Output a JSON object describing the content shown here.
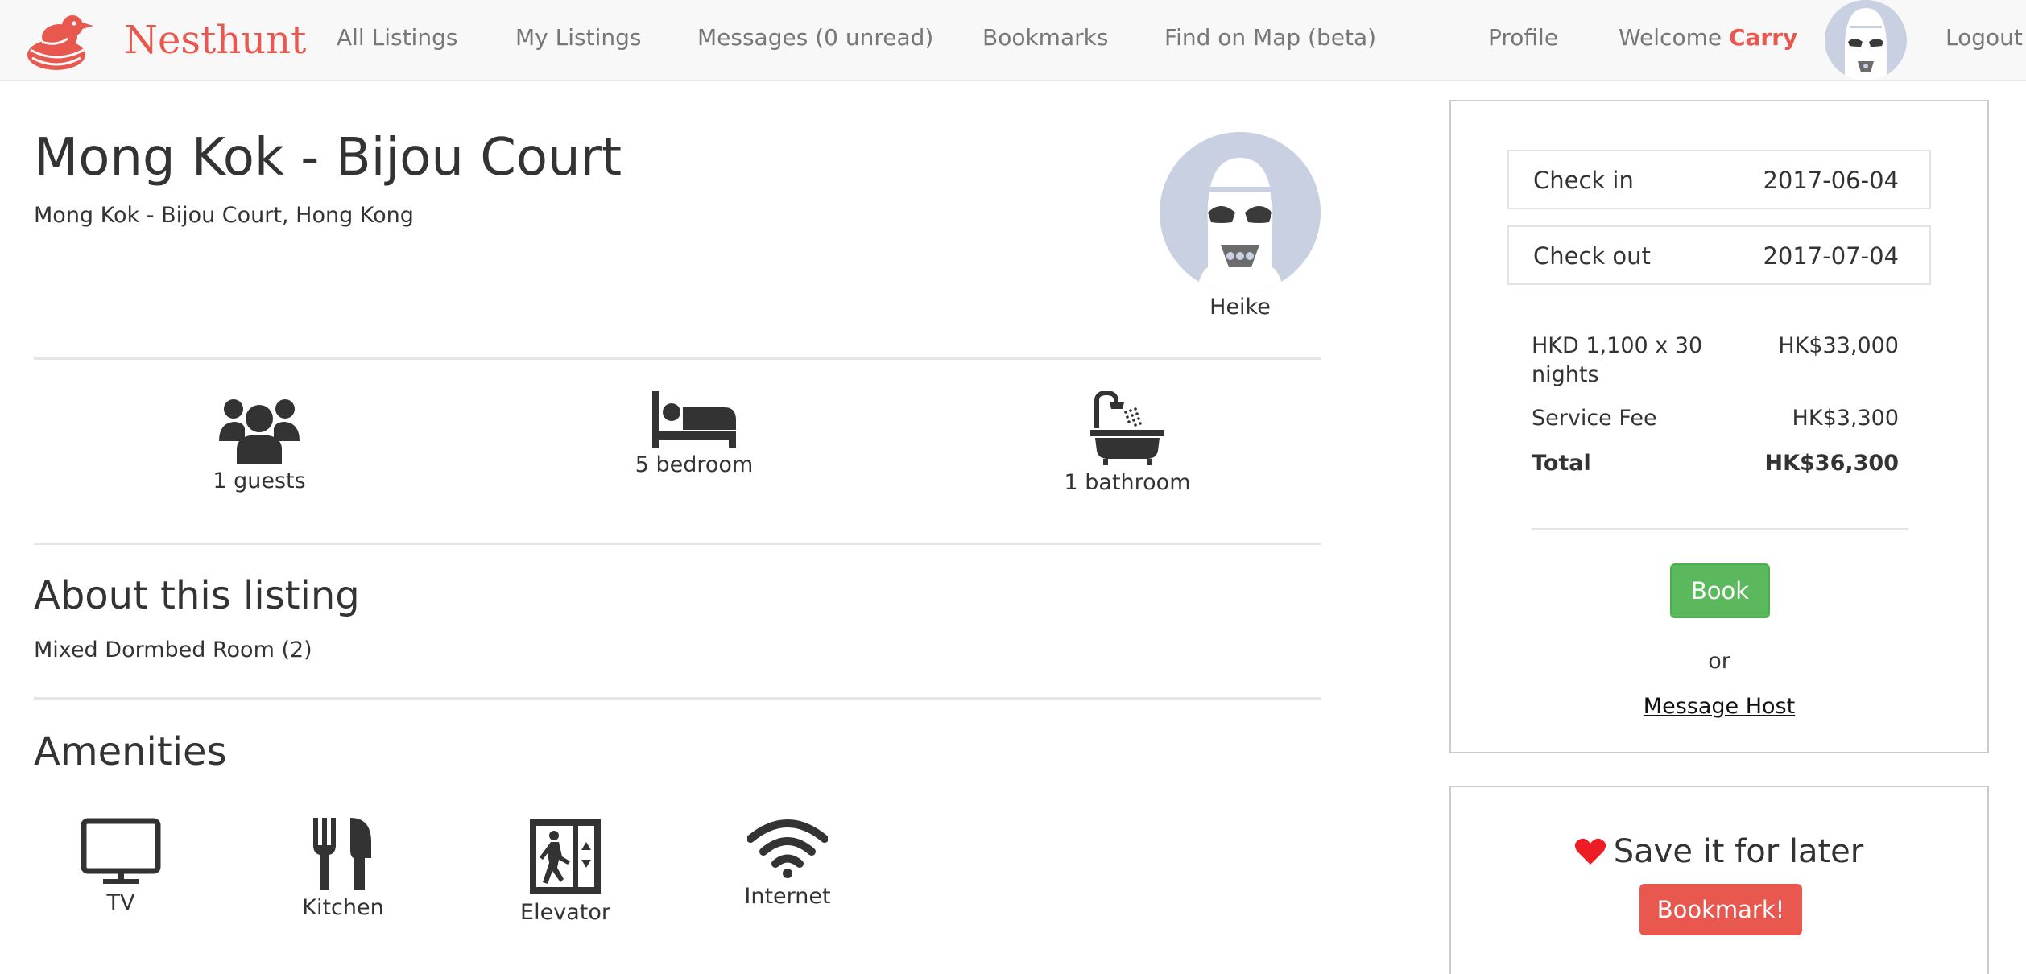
{
  "navbar": {
    "brand_name": "Nesthunt",
    "links": [
      {
        "label": "All Listings"
      },
      {
        "label": "My Listings"
      },
      {
        "label": "Messages (0 unread)"
      },
      {
        "label": "Bookmarks"
      },
      {
        "label": "Find on Map (beta)"
      },
      {
        "label": "Profile"
      }
    ],
    "welcome_prefix": "Welcome",
    "welcome_name": "Carry",
    "logout_label": "Logout"
  },
  "listing": {
    "title": "Mong Kok - Bijou Court",
    "address": "Mong Kok - Bijou Court, Hong Kong",
    "host_name": "Heike",
    "stats": {
      "guests": "1 guests",
      "bedrooms": "5 bedroom",
      "bathrooms": "1 bathroom"
    },
    "about_heading": "About this listing",
    "about_text": "Mixed Dormbed Room (2)",
    "amenities_heading": "Amenities",
    "amenities": [
      {
        "label": "TV",
        "icon": "tv-icon"
      },
      {
        "label": "Kitchen",
        "icon": "fork-knife-icon"
      },
      {
        "label": "Elevator",
        "icon": "elevator-icon"
      },
      {
        "label": "Internet",
        "icon": "wifi-icon"
      }
    ]
  },
  "booking": {
    "check_in_label": "Check in",
    "check_in_value": "2017-06-04",
    "check_out_label": "Check out",
    "check_out_value": "2017-07-04",
    "nightly_label": "HKD 1,100 x 30 nights",
    "nightly_value": "HK$33,000",
    "fee_label": "Service Fee",
    "fee_value": "HK$3,300",
    "total_label": "Total",
    "total_value": "HK$36,300",
    "book_label": "Book",
    "or_text": "or",
    "message_host_label": "Message Host"
  },
  "save": {
    "title": "Save it for later",
    "bookmark_label": "Bookmark!"
  },
  "colors": {
    "brand": "#e8584f",
    "book_button": "#5cb85c",
    "heart": "#ee1c25",
    "avatar_bg": "#c8d0e2"
  }
}
